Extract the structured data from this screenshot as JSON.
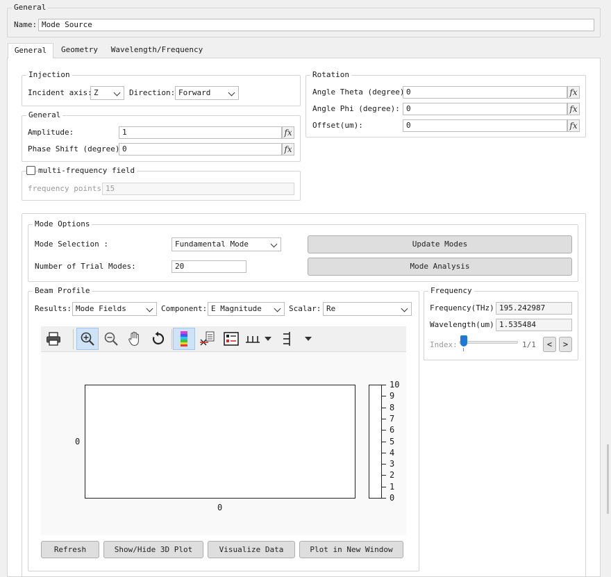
{
  "general_group": {
    "title": "General",
    "name_label": "Name:",
    "name_value": "Mode Source"
  },
  "tabs": [
    {
      "label": "General",
      "active": true
    },
    {
      "label": "Geometry",
      "active": false
    },
    {
      "label": "Wavelength/Frequency",
      "active": false
    }
  ],
  "injection": {
    "title": "Injection",
    "incident_axis_label": "Incident axis:",
    "incident_axis_value": "Z",
    "direction_label": "Direction:",
    "direction_value": "Forward"
  },
  "general_inner": {
    "title": "General",
    "amplitude_label": "Amplitude:",
    "amplitude_value": "1",
    "phase_label": "Phase Shift (degree):",
    "phase_value": "0",
    "fx": "fx"
  },
  "multi_freq": {
    "checkbox_label": "multi-frequency field",
    "checked": false,
    "points_label": "frequency points:",
    "points_value": "15"
  },
  "rotation": {
    "title": "Rotation",
    "theta_label": "Angle Theta (degree):",
    "theta_value": "0",
    "phi_label": "Angle Phi (degree):",
    "phi_value": "0",
    "offset_label": "Offset(um):",
    "offset_value": "0"
  },
  "mode_options": {
    "title": "Mode Options",
    "selection_label": "Mode Selection :",
    "selection_value": "Fundamental Mode",
    "trial_label": "Number of Trial Modes:",
    "trial_value": "20",
    "update_button": "Update Modes",
    "analysis_button": "Mode Analysis"
  },
  "beam_profile": {
    "title": "Beam Profile",
    "results_label": "Results:",
    "results_value": "Mode Fields",
    "component_label": "Component:",
    "component_value": "E Magnitude",
    "scalar_label": "Scalar:",
    "scalar_value": "Re",
    "toolbar_icons": [
      "print-icon",
      "zoom-in-icon",
      "zoom-out-icon",
      "pan-hand-icon",
      "reset-icon",
      "colormap-icon",
      "pick-point-icon",
      "legend-icon",
      "x-ticks-icon",
      "y-ticks-icon"
    ],
    "plot_y_label": "0",
    "plot_x_label": "0",
    "colorbar_ticks": [
      "10",
      "9",
      "8",
      "7",
      "6",
      "5",
      "4",
      "3",
      "2",
      "1",
      "0"
    ],
    "buttons": {
      "refresh": "Refresh",
      "show_hide_3d": "Show/Hide 3D Plot",
      "visualize": "Visualize Data",
      "plot_new_window": "Plot in New Window"
    }
  },
  "frequency": {
    "title": "Frequency",
    "freq_label": "Frequency(THz):",
    "freq_value": "195.242987",
    "wavelength_label": "Wavelength(um):",
    "wavelength_value": "1.535484",
    "index_label": "Index:",
    "index_counter": "1/1",
    "index_fraction": 0,
    "prev": "<",
    "next": ">"
  },
  "colors": {
    "window_bg": "#f0f0f0",
    "panel_bg": "#ffffff",
    "accent": "#1d78d6",
    "toolbar_active": "#cfe3f7"
  }
}
